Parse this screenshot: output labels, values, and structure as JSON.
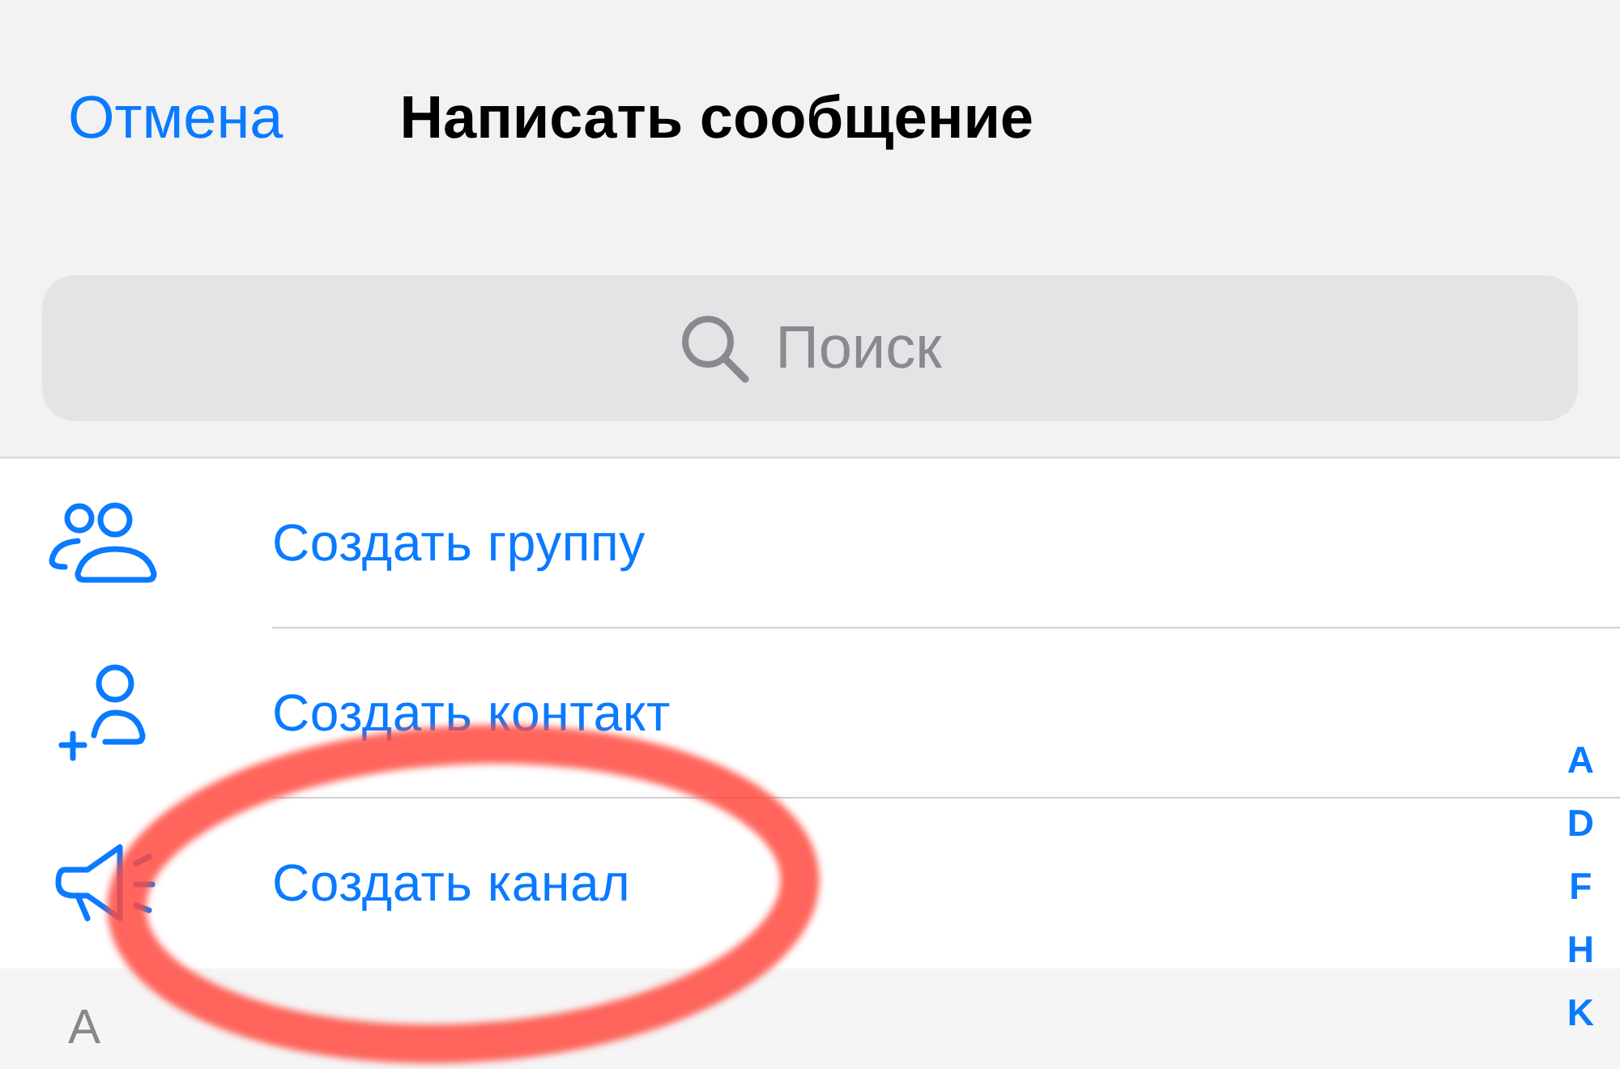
{
  "nav": {
    "cancel": "Отмена",
    "title": "Написать сообщение"
  },
  "search": {
    "placeholder": "Поиск"
  },
  "actions": [
    {
      "kind": "group",
      "label": "Создать группу"
    },
    {
      "kind": "contact",
      "label": "Создать контакт"
    },
    {
      "kind": "channel",
      "label": "Создать канал"
    }
  ],
  "section": {
    "header": "A"
  },
  "index": [
    "A",
    "D",
    "F",
    "H",
    "K"
  ],
  "annotation": {
    "kind": "ellipse"
  }
}
